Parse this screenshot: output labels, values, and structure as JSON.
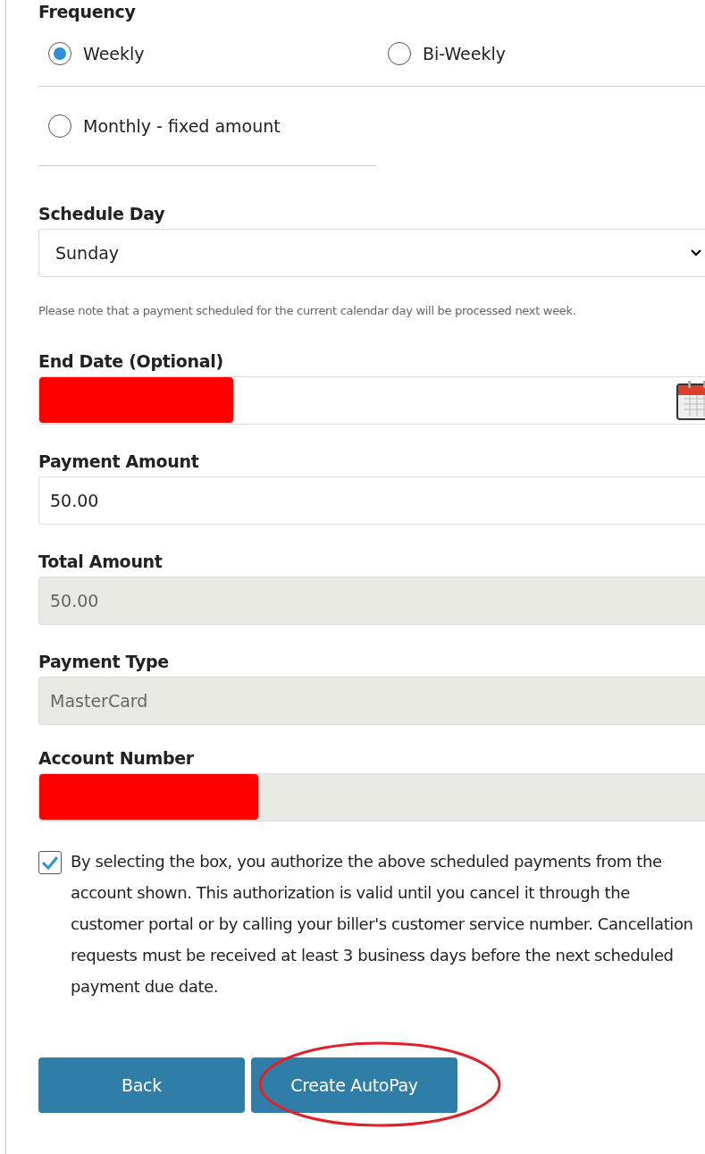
{
  "frequency": {
    "label": "Frequency",
    "options": [
      {
        "label": "Weekly",
        "selected": true
      },
      {
        "label": "Bi-Weekly",
        "selected": false
      },
      {
        "label": "Monthly - fixed amount",
        "selected": false
      }
    ]
  },
  "schedule_day": {
    "label": "Schedule Day",
    "value": "Sunday",
    "note": "Please note that a payment scheduled for the current calendar day will be processed next week."
  },
  "fields": [
    {
      "kind": "date",
      "label": "End Date (Optional)",
      "redacted": true,
      "disabled": false
    },
    {
      "kind": "text",
      "label": "Payment Amount",
      "value": "50.00",
      "disabled": false
    },
    {
      "kind": "text",
      "label": "Total Amount",
      "value": "50.00",
      "disabled": true
    },
    {
      "kind": "text",
      "label": "Payment Type",
      "value": "MasterCard",
      "disabled": true
    },
    {
      "kind": "text",
      "label": "Account Number",
      "redacted": true,
      "disabled": true
    }
  ],
  "authorization": {
    "checked": true,
    "text": "By selecting the box, you authorize the above scheduled payments from the account shown. This authorization is valid until you cancel it through the customer portal or by calling your biller's customer service number. Cancellation requests must be received at least 3 business days before the next scheduled payment due date."
  },
  "buttons": [
    {
      "label": "Back",
      "circled": false
    },
    {
      "label": "Create AutoPay",
      "circled": true
    }
  ]
}
